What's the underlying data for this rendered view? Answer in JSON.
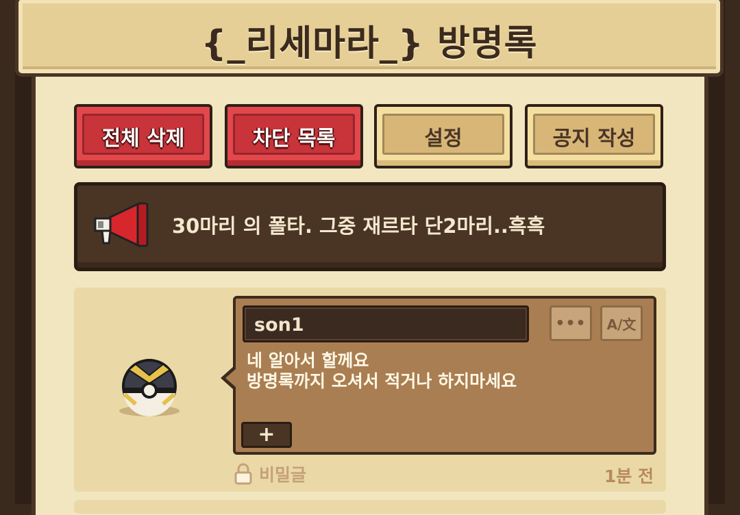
{
  "header": {
    "title": "{_리세마라_} 방명록"
  },
  "toolbar": {
    "delete_all": "전체 삭제",
    "block_list": "차단 목록",
    "settings": "설정",
    "write_notice": "공지 작성"
  },
  "notice": {
    "text": "30마리 의 폴타. 그중 재르타 단2마리..흑흑"
  },
  "entries": [
    {
      "author": "son1",
      "message_lines": [
        "네 알아서 할께요",
        "방명록까지 오셔서 적거나 하지마세요"
      ],
      "more_label": "•••",
      "translate_label": "A/文",
      "plus_label": "+",
      "secret_label": "비밀글",
      "time": "1분 전"
    }
  ],
  "colors": {
    "red_button": "#e2474c",
    "tan_button": "#f5dfa0",
    "panel": "#f1e6bf",
    "bubble": "#a97e52",
    "frame": "#4a3525"
  },
  "icons": {
    "megaphone": "megaphone-icon",
    "avatar": "pokeball-avatar",
    "lock": "lock-icon"
  }
}
